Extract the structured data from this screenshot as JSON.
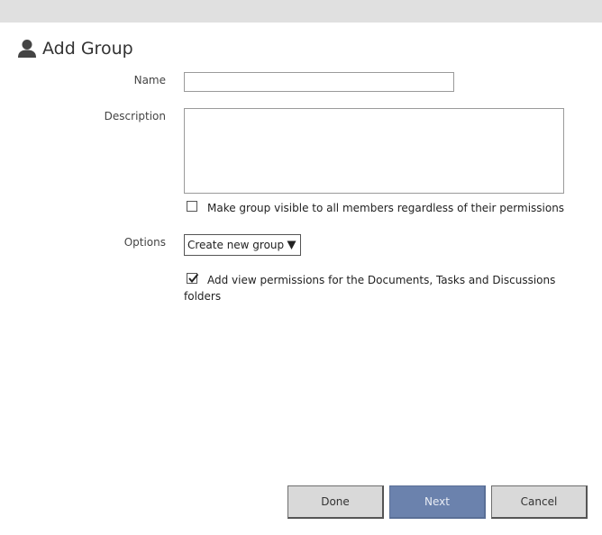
{
  "dialog": {
    "title": "Add Group",
    "title_icon": "user-icon"
  },
  "form": {
    "name_label": "Name",
    "name_value": "",
    "description_label": "Description",
    "description_value": "",
    "visible_checkbox": {
      "label": "Make group visible to all members regardless of their permissions",
      "checked": false
    },
    "options_label": "Options",
    "options_select": {
      "selected": "Create new group",
      "arrow_icon": "triangle-down-icon"
    },
    "permissions_checkbox": {
      "label_line1": "Add view permissions for the Documents, Tasks and Discussions",
      "label_line2": "folders",
      "checked": true
    }
  },
  "buttons": {
    "done": "Done",
    "next": "Next",
    "cancel": "Cancel"
  },
  "colors": {
    "top_bar": "#e0e0e0",
    "primary_button": "#6b82ad",
    "secondary_button": "#d9d9d9"
  }
}
